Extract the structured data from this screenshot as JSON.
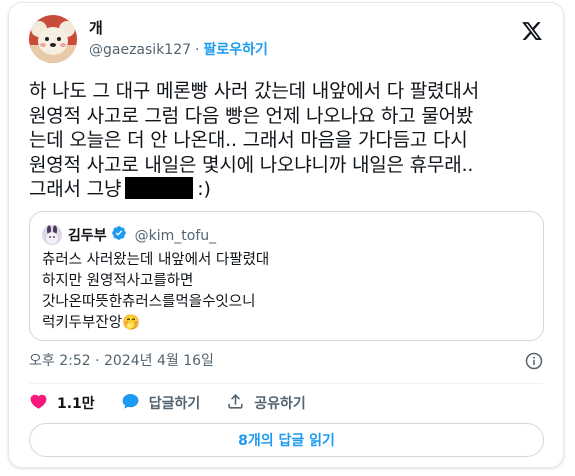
{
  "author": {
    "display_name": "개",
    "handle": "@gaezasik127",
    "separator": "·",
    "follow_label": "팔로우하기"
  },
  "tweet": {
    "lines": [
      "하 나도 그 대구 메론빵 사러 갔는데 내앞에서 다 팔렸대서",
      "원영적 사고로 그럼 다음 빵은 언제 나오나요 하고 물어봤",
      "는데 오늘은 더 안 나온대.. 그래서 마음을 가다듬고 다시",
      "원영적 사고로 내일은 몇시에 나오냐니까 내일은 휴무래..",
      "그래서 그냥"
    ],
    "after_redaction": ":)"
  },
  "quote": {
    "display_name": "김두부",
    "handle": "@kim_tofu_",
    "lines": [
      "츄러스 사러왔는데 내앞에서 다팔렸대",
      "하지만 원영적사고를하면",
      "갓나온따뜻한츄러스를먹을수잇으니",
      "럭키두부잔앙"
    ],
    "emoji": "🤭"
  },
  "timestamp": "오후 2:52 · 2024년 4월 16일",
  "actions": {
    "likes": "1.1만",
    "reply_label": "답글하기",
    "share_label": "공유하기"
  },
  "replies_button": "8개의 답글 읽기",
  "colors": {
    "accent": "#1d9bf0",
    "like": "#f91880",
    "muted": "#536471",
    "text": "#0f1419",
    "border": "#cfd9de"
  },
  "icons": {
    "logo": "x-logo-icon",
    "like": "heart-icon",
    "reply": "reply-bubble-icon",
    "share": "share-icon",
    "info": "info-icon",
    "verified": "verified-badge-icon"
  }
}
